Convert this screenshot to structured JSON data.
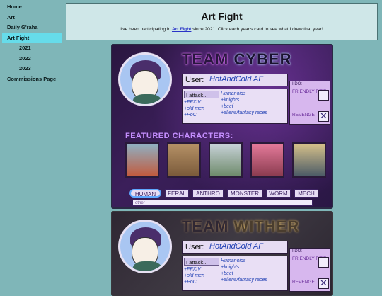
{
  "sidebar": {
    "items": [
      {
        "label": "Home"
      },
      {
        "label": "Art"
      },
      {
        "label": "Daily G'raha"
      },
      {
        "label": "Art Fight"
      },
      {
        "label": "2021"
      },
      {
        "label": "2022"
      },
      {
        "label": "2023"
      },
      {
        "label": "Commissions Page"
      }
    ],
    "active": "Art Fight"
  },
  "header": {
    "title": "Art Fight",
    "desc_before": "I've been participating in ",
    "link": "Art Fight",
    "desc_after": " since 2021. Click each year's card to see what I drew that year!"
  },
  "cards": [
    {
      "team_word": "TEAM",
      "team_name": "CYBER",
      "user_label": "User:",
      "user_value": "HotAndCold AF",
      "attack_label": "I attack...",
      "attack_col1": [
        "+FFXIV",
        "+old men",
        "+PoC"
      ],
      "attack_col2": [
        "Humanoids",
        "+knights",
        "+beef",
        "+aliens/fantasy races"
      ],
      "i_do": "I DO:",
      "friendly_fire": "FRIENDLY FIRE",
      "revenge": "REVENGE",
      "featured": "FEATURED CHARACTERS:",
      "tags": [
        "HUMAN",
        "FERAL",
        "ANTHRO",
        "MONSTER",
        "WORM",
        "MECH"
      ],
      "other": "other"
    },
    {
      "team_word": "TEAM",
      "team_name": "WITHER",
      "user_label": "User:",
      "user_value": "HotAndCold AF",
      "attack_label": "I attack...",
      "attack_col1": [
        "+FFXIV",
        "+old men",
        "+PoC"
      ],
      "attack_col2": [
        "Humanoids",
        "+knights",
        "+beef",
        "+aliens/fantasy races"
      ],
      "i_do": "I DO:",
      "friendly_fire": "FRIENDLY FIRE",
      "revenge": "REVENGE"
    }
  ],
  "colors": {
    "accent": "#66dcea",
    "link": "#2a34c7",
    "page_bg": "#7fb6b8"
  }
}
